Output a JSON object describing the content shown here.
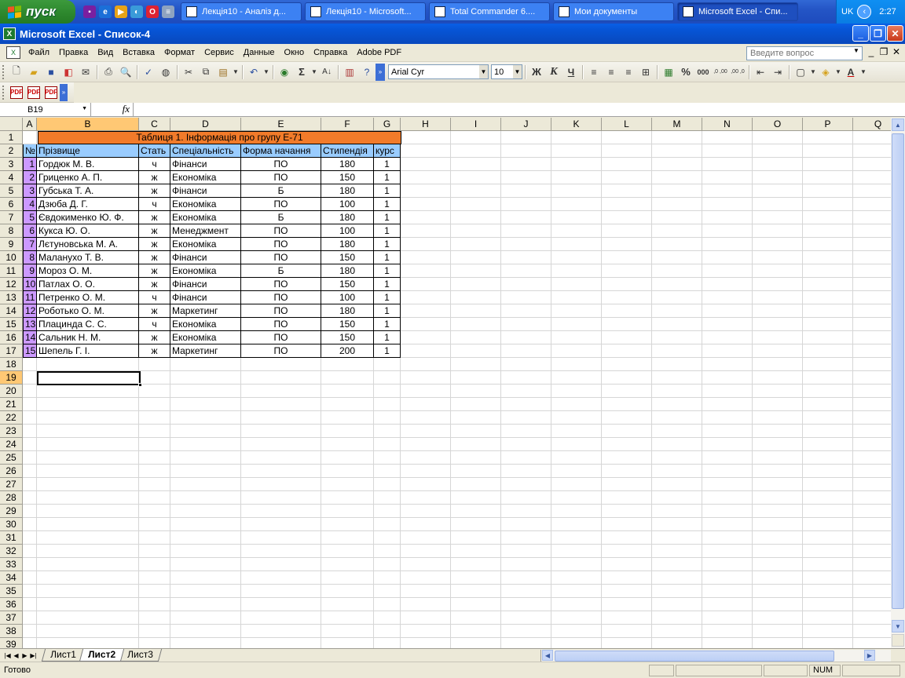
{
  "taskbar": {
    "start_label": "пуск",
    "tasks": [
      {
        "label": "Лекція10 - Аналіз д..."
      },
      {
        "label": "Лекція10 - Microsoft..."
      },
      {
        "label": "Total Commander 6...."
      },
      {
        "label": "Мои документы"
      },
      {
        "label": "Microsoft Excel - Спи..."
      }
    ],
    "lang": "UK",
    "clock": "2:27"
  },
  "window": {
    "title": "Microsoft Excel - Список-4"
  },
  "menu": {
    "items": [
      "Файл",
      "Правка",
      "Вид",
      "Вставка",
      "Формат",
      "Сервис",
      "Данные",
      "Окно",
      "Справка",
      "Adobe PDF"
    ],
    "help_placeholder": "Введите вопрос"
  },
  "toolbar": {
    "font_name": "Arial Cyr",
    "font_size": "10",
    "bold": "Ж",
    "italic": "К",
    "underline": "Ч",
    "percent": "%",
    "thousands": "000",
    "inc_dec": ",0 ,00",
    "dec_dec": ",00 ,0"
  },
  "formula_bar": {
    "name_box": "B19",
    "fx": "fx",
    "value": ""
  },
  "sheet": {
    "columns": [
      "A",
      "B",
      "C",
      "D",
      "E",
      "F",
      "G",
      "H",
      "I",
      "J",
      "K",
      "L",
      "M",
      "N",
      "O",
      "P",
      "Q"
    ],
    "row_count": 39,
    "active_row": 19,
    "active_col": "B",
    "title": "Таблиця 1. Інформація про групу Е-71",
    "headers": [
      "№",
      "Прізвище",
      "Стать",
      "Спеціальність",
      "Форма начання",
      "Стипендія",
      "курс"
    ],
    "rows": [
      [
        "1",
        "Гордюк М. В.",
        "ч",
        "Фінанси",
        "ПО",
        "180",
        "1"
      ],
      [
        "2",
        "Гриценко А. П.",
        "ж",
        "Економіка",
        "ПО",
        "150",
        "1"
      ],
      [
        "3",
        "Губська Т. А.",
        "ж",
        "Фінанси",
        "Б",
        "180",
        "1"
      ],
      [
        "4",
        "Дзюба Д. Г.",
        "ч",
        "Економіка",
        "ПО",
        "100",
        "1"
      ],
      [
        "5",
        "Євдокименко Ю. Ф.",
        "ж",
        "Економіка",
        "Б",
        "180",
        "1"
      ],
      [
        "6",
        "Кукса Ю. О.",
        "ж",
        "Менеджмент",
        "ПО",
        "100",
        "1"
      ],
      [
        "7",
        "Лєтуновська М. А.",
        "ж",
        "Економіка",
        "ПО",
        "180",
        "1"
      ],
      [
        "8",
        "Маланухо Т. В.",
        "ж",
        "Фінанси",
        "ПО",
        "150",
        "1"
      ],
      [
        "9",
        "Мороз О. М.",
        "ж",
        "Економіка",
        "Б",
        "180",
        "1"
      ],
      [
        "10",
        "Патлах О. О.",
        "ж",
        "Фінанси",
        "ПО",
        "150",
        "1"
      ],
      [
        "11",
        "Петренко О. М.",
        "ч",
        "Фінанси",
        "ПО",
        "100",
        "1"
      ],
      [
        "12",
        "Роботько О. М.",
        "ж",
        "Маркетинг",
        "ПО",
        "180",
        "1"
      ],
      [
        "13",
        "Плацинда С. С.",
        "ч",
        "Економіка",
        "ПО",
        "150",
        "1"
      ],
      [
        "14",
        "Сальник Н. М.",
        "ж",
        "Економіка",
        "ПО",
        "150",
        "1"
      ],
      [
        "15",
        "Шепель Г. І.",
        "ж",
        "Маркетинг",
        "ПО",
        "200",
        "1"
      ]
    ],
    "tabs": [
      "Лист1",
      "Лист2",
      "Лист3"
    ],
    "active_tab": "Лист2"
  },
  "status": {
    "text": "Готово",
    "num": "NUM"
  },
  "colors": {
    "title_fill": "#f27b2a",
    "header_fill": "#99ccff",
    "number_fill": "#cc99ff",
    "selected_header": "#ffc874"
  }
}
